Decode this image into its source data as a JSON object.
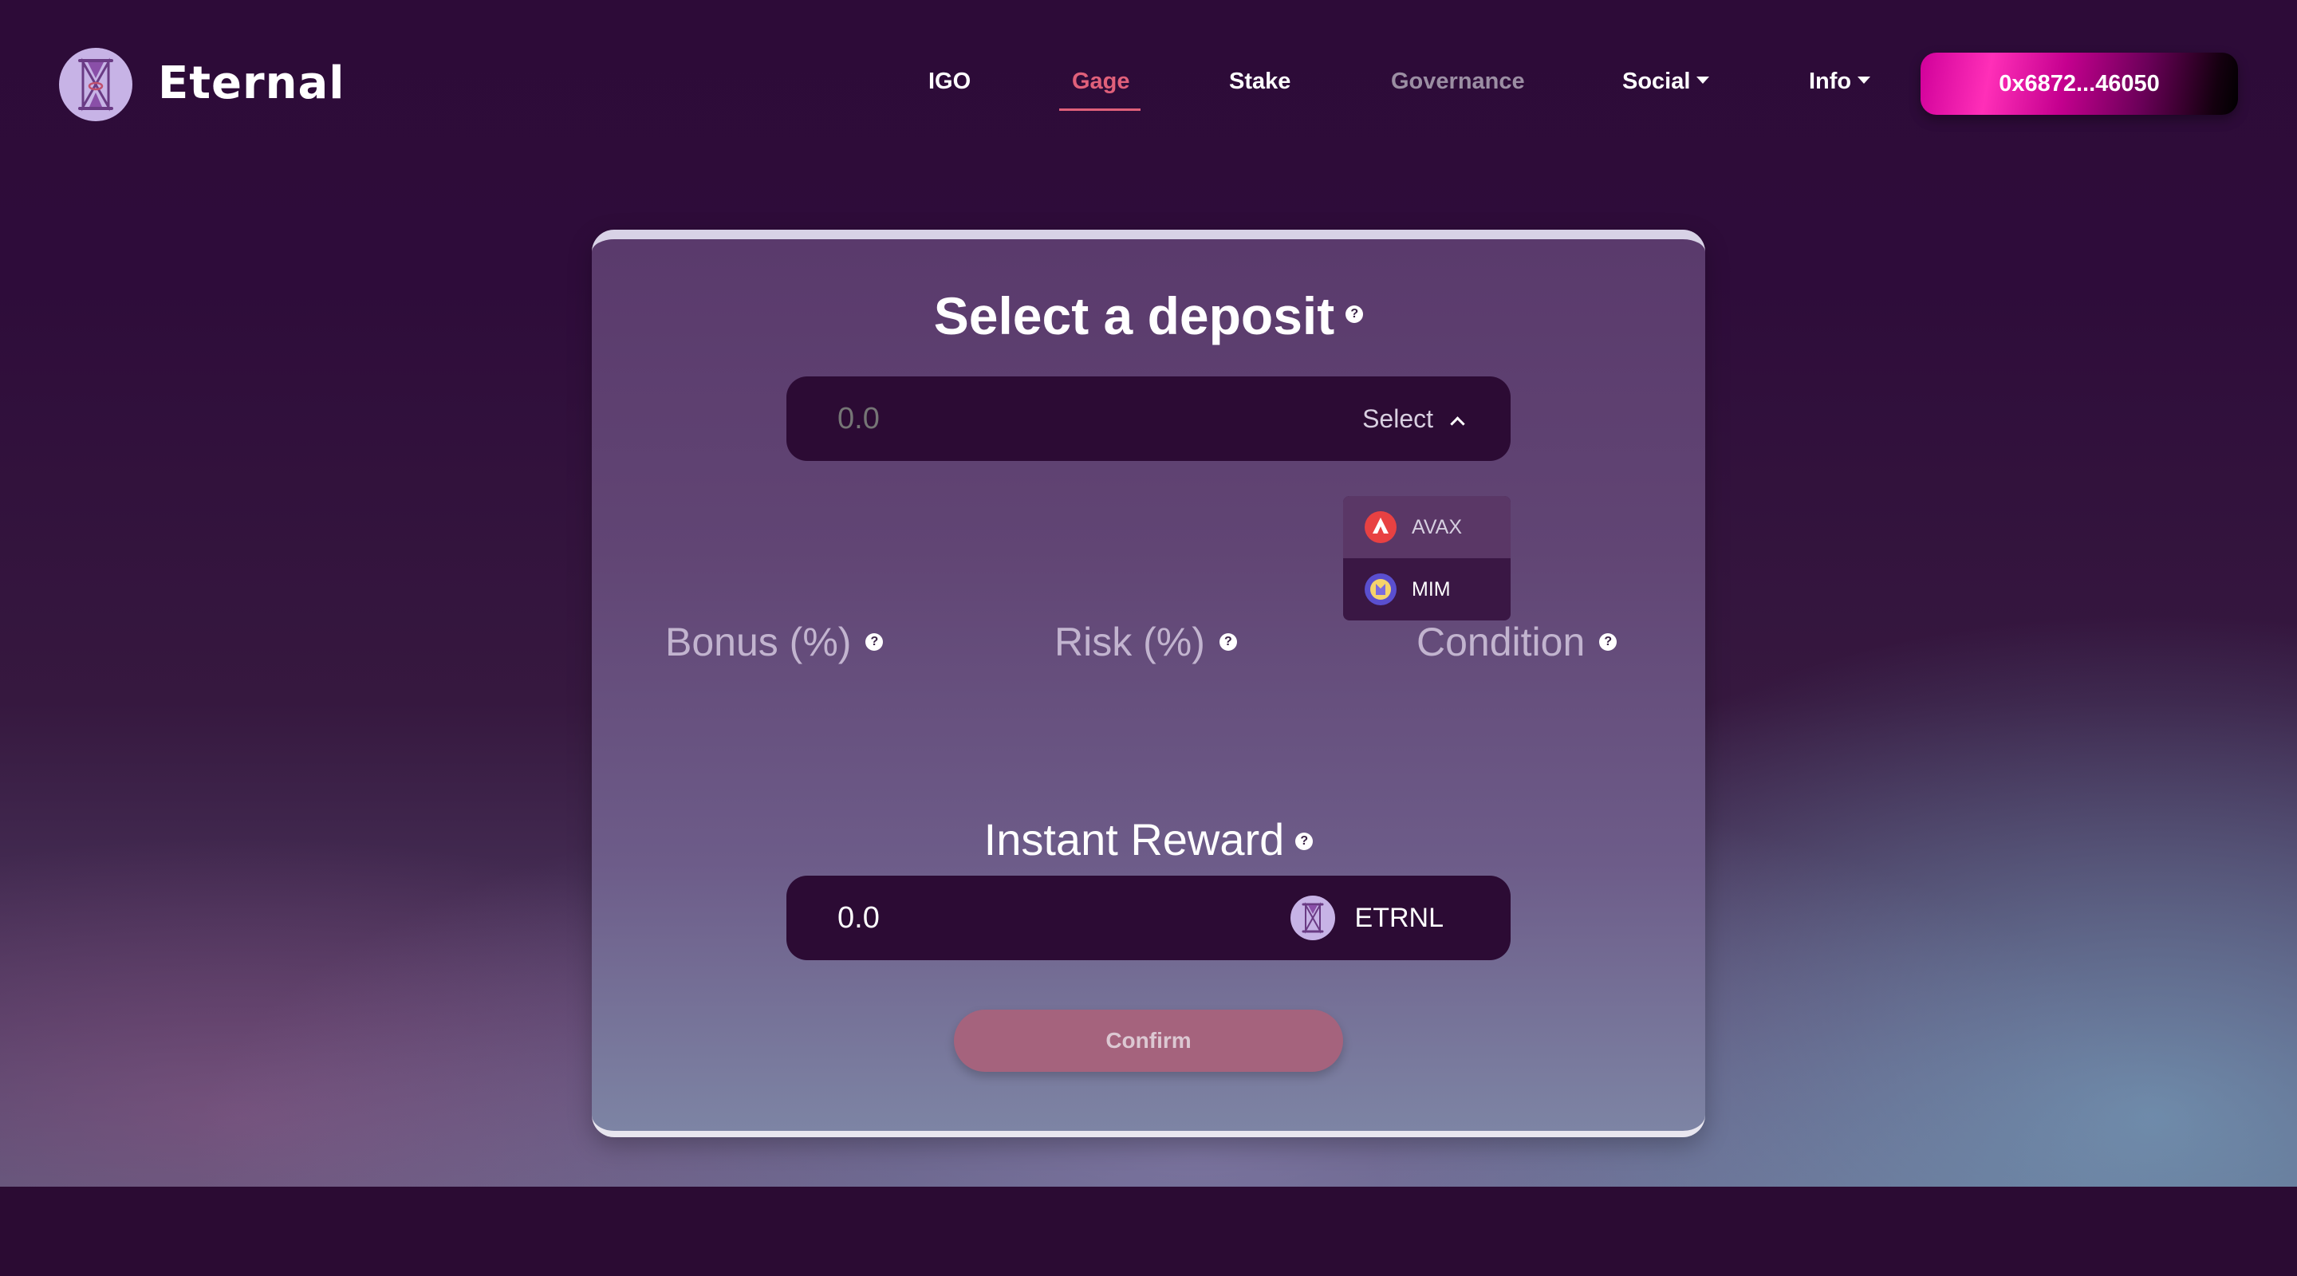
{
  "header": {
    "brand": "Eternal",
    "nav": [
      {
        "label": "IGO"
      },
      {
        "label": "Gage"
      },
      {
        "label": "Stake"
      },
      {
        "label": "Governance"
      },
      {
        "label": "Social"
      },
      {
        "label": "Info"
      }
    ],
    "active_nav": "Gage",
    "wallet_address": "0x6872...46050"
  },
  "deposit": {
    "title": "Select a deposit",
    "help": "?",
    "amount_placeholder": "0.0",
    "select_label": "Select",
    "options": [
      {
        "label": "AVAX",
        "icon": "avax-icon"
      },
      {
        "label": "MIM",
        "icon": "mim-icon"
      }
    ]
  },
  "stats": {
    "bonus_label": "Bonus (%)",
    "risk_label": "Risk (%)",
    "condition_label": "Condition"
  },
  "reward": {
    "title": "Instant Reward",
    "value": "0.0",
    "token": "ETRNL"
  },
  "confirm_label": "Confirm",
  "colors": {
    "accent": "#e0607a",
    "background": "#2b0b33",
    "field": "#2c0b34",
    "confirm": "#a5637d"
  }
}
